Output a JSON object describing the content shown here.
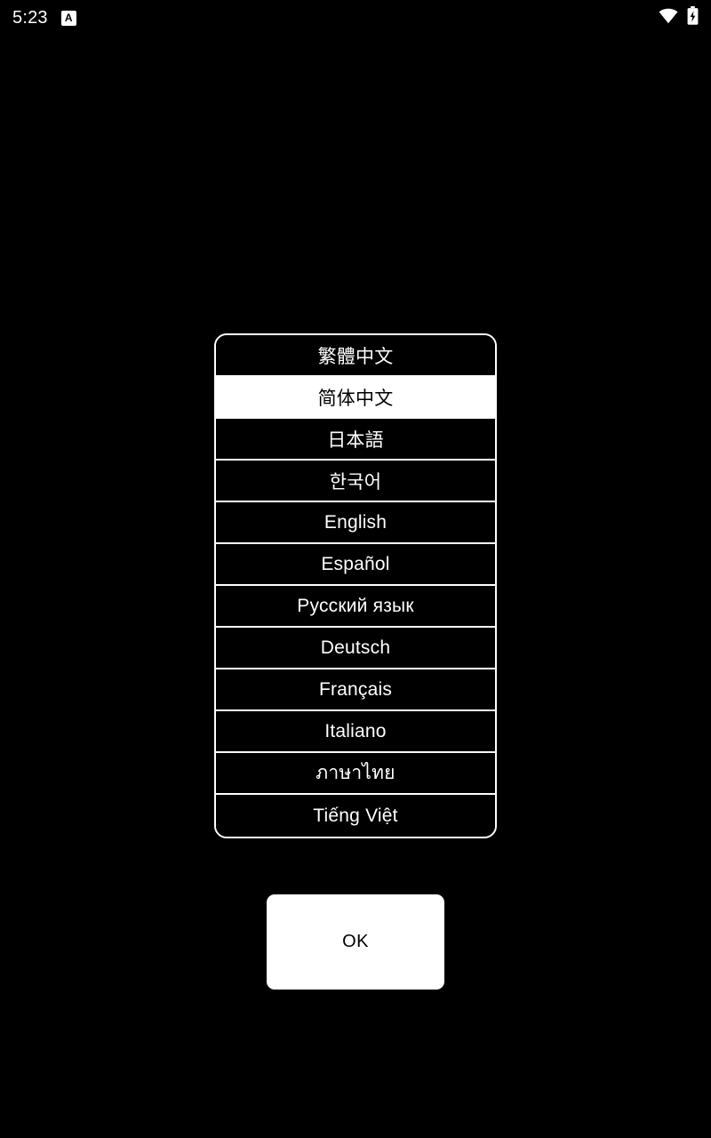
{
  "status_bar": {
    "clock": "5:23",
    "notification_icon": "app-notification-icon",
    "notification_glyph": "A",
    "wifi_icon": "wifi-icon",
    "battery_icon": "battery-charging-icon"
  },
  "colors": {
    "background": "#000000",
    "foreground": "#ffffff",
    "selected_background": "#ffffff",
    "selected_foreground": "#000000"
  },
  "language_list": {
    "selected_index": 1,
    "items": [
      {
        "label": "繁體中文"
      },
      {
        "label": "简体中文"
      },
      {
        "label": "日本語"
      },
      {
        "label": "한국어"
      },
      {
        "label": "English"
      },
      {
        "label": "Español"
      },
      {
        "label": "Русский язык"
      },
      {
        "label": "Deutsch"
      },
      {
        "label": "Français"
      },
      {
        "label": "Italiano"
      },
      {
        "label": "ภาษาไทย"
      },
      {
        "label": "Tiếng Việt"
      }
    ]
  },
  "confirm": {
    "ok_label": "OK"
  }
}
